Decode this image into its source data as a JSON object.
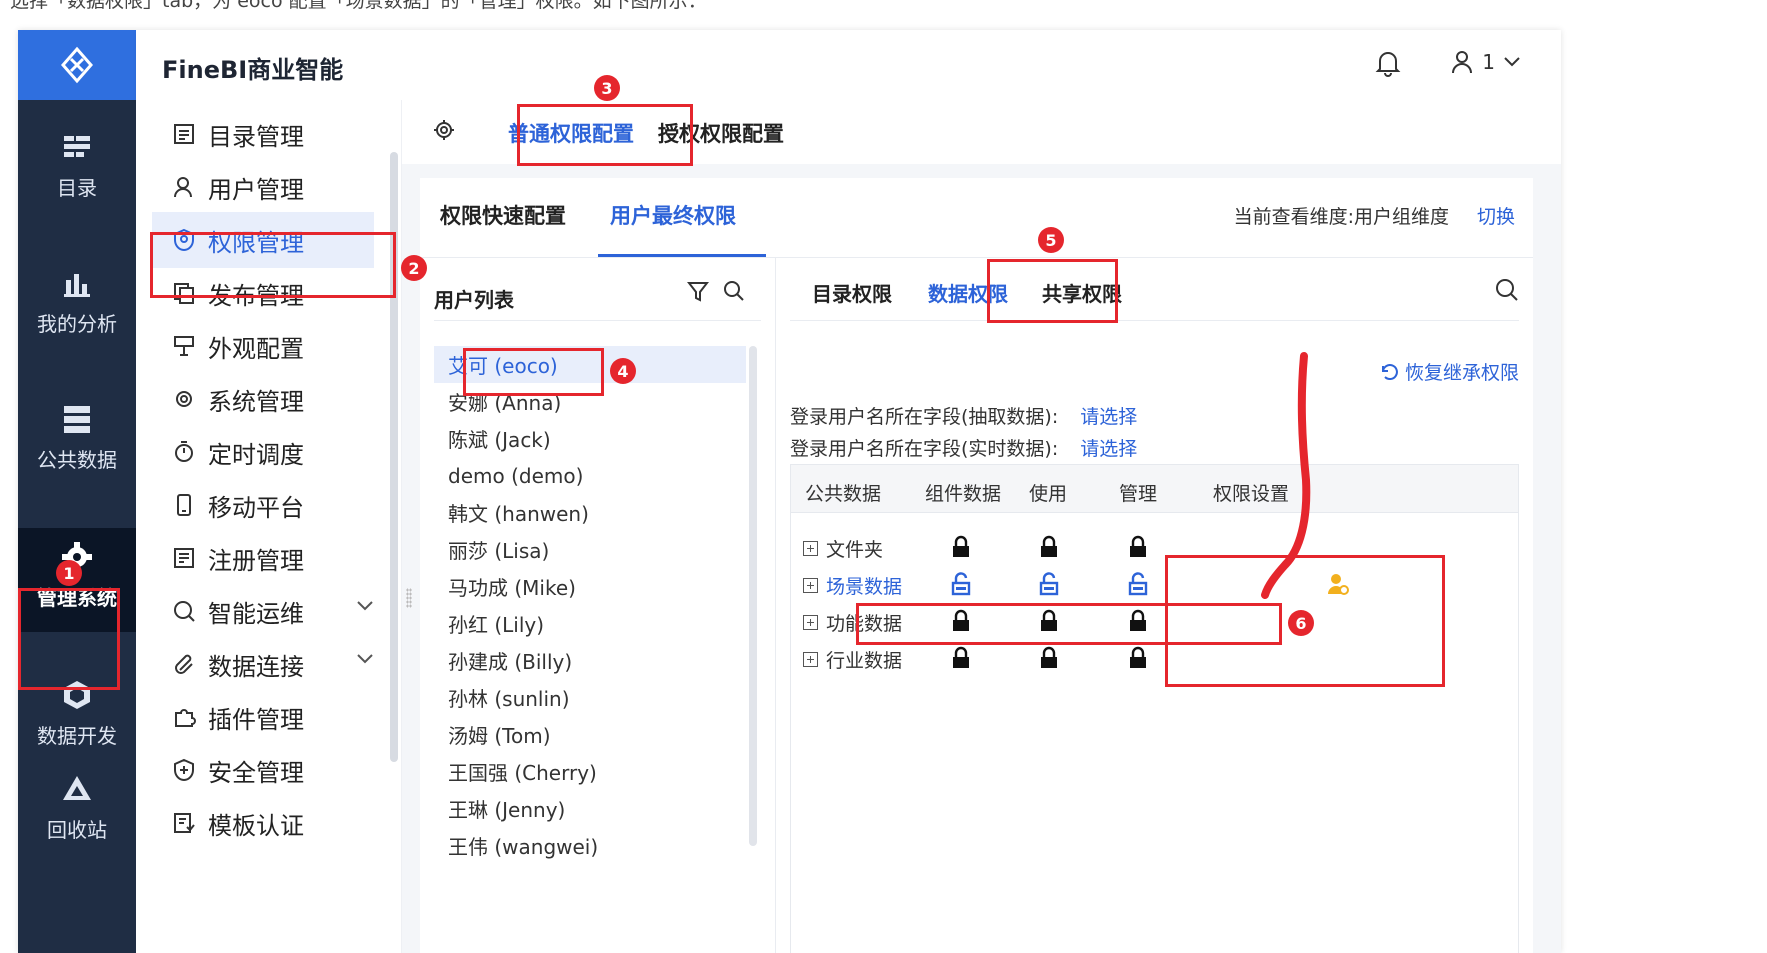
{
  "top_caption": "选择「数据权限」tab，为 eoco 配置「场景数据」的「管理」权限。如下图所示：",
  "header": {
    "brand": "FineBI商业智能",
    "user_name": "1"
  },
  "rail": {
    "items": [
      {
        "label": "目录",
        "icon": "catalog-icon"
      },
      {
        "label": "我的分析",
        "icon": "analysis-icon"
      },
      {
        "label": "公共数据",
        "icon": "public-data-icon"
      },
      {
        "label": "管理系统",
        "icon": "system-gear-icon"
      },
      {
        "label": "数据开发",
        "icon": "data-dev-icon"
      },
      {
        "label": "回收站",
        "icon": "recycle-icon"
      }
    ]
  },
  "menu": {
    "items": [
      {
        "label": "目录管理"
      },
      {
        "label": "用户管理"
      },
      {
        "label": "权限管理"
      },
      {
        "label": "发布管理"
      },
      {
        "label": "外观配置"
      },
      {
        "label": "系统管理"
      },
      {
        "label": "定时调度"
      },
      {
        "label": "移动平台"
      },
      {
        "label": "注册管理"
      },
      {
        "label": "智能运维"
      },
      {
        "label": "数据连接"
      },
      {
        "label": "插件管理"
      },
      {
        "label": "安全管理"
      },
      {
        "label": "模板认证"
      }
    ]
  },
  "tabs_top": {
    "normal": "普通权限配置",
    "grant": "授权权限配置"
  },
  "tabs_second": {
    "quick": "权限快速配置",
    "final": "用户最终权限"
  },
  "dimension": {
    "text": "当前查看维度:用户组维度",
    "switch": "切换"
  },
  "user_list": {
    "title": "用户列表",
    "users": [
      "艾可 (eoco)",
      "安娜 (Anna)",
      "陈斌 (Jack)",
      "demo (demo)",
      "韩文 (hanwen)",
      "丽莎 (Lisa)",
      "马功成 (Mike)",
      "孙红 (Lily)",
      "孙建成 (Billy)",
      "孙林 (sunlin)",
      "汤姆 (Tom)",
      "王国强 (Cherry)",
      "王琳 (Jenny)",
      "王伟 (wangwei)"
    ]
  },
  "perm_tabs": {
    "catalog": "目录权限",
    "data": "数据权限",
    "share": "共享权限"
  },
  "restore": "恢复继承权限",
  "fields": {
    "extract_label": "登录用户名所在字段(抽取数据):",
    "realtime_label": "登录用户名所在字段(实时数据):",
    "pick": "请选择"
  },
  "table": {
    "headers": {
      "public": "公共数据",
      "component": "组件数据",
      "use": "使用",
      "manage": "管理",
      "setting": "权限设置"
    },
    "rows": [
      {
        "name": "文件夹",
        "component": "locked",
        "use": "locked",
        "manage": "locked"
      },
      {
        "name": "场景数据",
        "component": "unlocked",
        "use": "unlocked",
        "manage": "unlocked"
      },
      {
        "name": "功能数据",
        "component": "locked",
        "use": "locked",
        "manage": "locked"
      },
      {
        "name": "行业数据",
        "component": "locked",
        "use": "locked",
        "manage": "locked"
      }
    ]
  },
  "annotations": {
    "b1": "1",
    "b2": "2",
    "b3": "3",
    "b4": "4",
    "b5": "5",
    "b6": "6"
  },
  "colors": {
    "accent": "#2d63d8",
    "rail": "#1f2d44",
    "annotation": "#e5262d"
  }
}
